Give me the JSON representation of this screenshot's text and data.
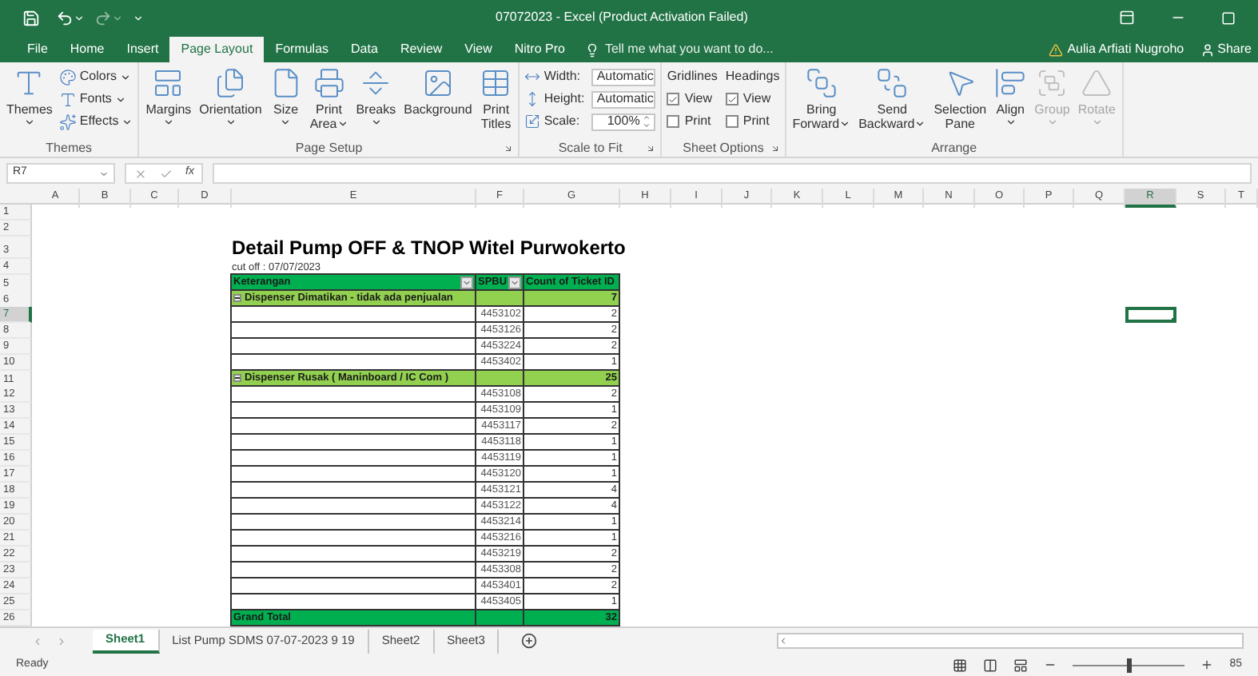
{
  "window": {
    "title": "07072023 - Excel (Product Activation Failed)"
  },
  "tabs": [
    {
      "label": "File",
      "selected": false
    },
    {
      "label": "Home",
      "selected": false
    },
    {
      "label": "Insert",
      "selected": false
    },
    {
      "label": "Page Layout",
      "selected": true
    },
    {
      "label": "Formulas",
      "selected": false
    },
    {
      "label": "Data",
      "selected": false
    },
    {
      "label": "Review",
      "selected": false
    },
    {
      "label": "View",
      "selected": false
    },
    {
      "label": "Nitro Pro",
      "selected": false
    }
  ],
  "tell_me": {
    "placeholder": "Tell me what you want to do..."
  },
  "account": {
    "name": "Aulia Arfiati Nugroho",
    "share": "Share"
  },
  "ribbon": {
    "groups": [
      {
        "label": "Themes",
        "launcher": false,
        "items": [
          {
            "kind": "large",
            "lines": [
              "Themes"
            ],
            "dropdown": true,
            "disabled": false
          },
          {
            "kind": "stack",
            "entries": [
              {
                "label": "Colors",
                "dropdown": true
              },
              {
                "label": "Fonts",
                "dropdown": true
              },
              {
                "label": "Effects",
                "dropdown": true
              }
            ]
          }
        ]
      },
      {
        "label": "Page Setup",
        "launcher": true,
        "items": [
          {
            "kind": "large",
            "lines": [
              "Margins"
            ],
            "dropdown": true,
            "disabled": false
          },
          {
            "kind": "large",
            "lines": [
              "Orientation"
            ],
            "dropdown": true,
            "disabled": false
          },
          {
            "kind": "large",
            "lines": [
              "Size"
            ],
            "dropdown": true,
            "disabled": false
          },
          {
            "kind": "large",
            "lines": [
              "Print",
              "Area"
            ],
            "dropdown": true,
            "disabled": false
          },
          {
            "kind": "large",
            "lines": [
              "Breaks"
            ],
            "dropdown": true,
            "disabled": false
          },
          {
            "kind": "large",
            "lines": [
              "Background"
            ],
            "dropdown": false,
            "disabled": false
          },
          {
            "kind": "large",
            "lines": [
              "Print",
              "Titles"
            ],
            "dropdown": false,
            "disabled": false
          }
        ]
      },
      {
        "label": "Scale to Fit",
        "launcher": true,
        "items": [
          {
            "kind": "scale",
            "rows": [
              {
                "label": "Width:",
                "value": "Automatic",
                "kind": "dropdown"
              },
              {
                "label": "Height:",
                "value": "Automatic",
                "kind": "dropdown"
              },
              {
                "label": "Scale:",
                "value": "100%",
                "kind": "spinner"
              }
            ]
          }
        ]
      },
      {
        "label": "Sheet Options",
        "launcher": true,
        "items": [
          {
            "kind": "options",
            "columns": [
              {
                "title": "Gridlines",
                "options": [
                  {
                    "label": "View",
                    "checked": true
                  },
                  {
                    "label": "Print",
                    "checked": false
                  }
                ]
              },
              {
                "title": "Headings",
                "options": [
                  {
                    "label": "View",
                    "checked": true
                  },
                  {
                    "label": "Print",
                    "checked": false
                  }
                ]
              }
            ]
          }
        ]
      },
      {
        "label": "Arrange",
        "launcher": false,
        "items": [
          {
            "kind": "large",
            "lines": [
              "Bring",
              "Forward"
            ],
            "dropdown": true,
            "disabled": false
          },
          {
            "kind": "large",
            "lines": [
              "Send",
              "Backward"
            ],
            "dropdown": true,
            "disabled": false
          },
          {
            "kind": "large",
            "lines": [
              "Selection",
              "Pane"
            ],
            "dropdown": false,
            "disabled": false
          },
          {
            "kind": "large",
            "lines": [
              "Align"
            ],
            "dropdown": true,
            "disabled": false
          },
          {
            "kind": "large",
            "lines": [
              "Group"
            ],
            "dropdown": true,
            "disabled": true
          },
          {
            "kind": "large",
            "lines": [
              "Rotate"
            ],
            "dropdown": true,
            "disabled": true
          }
        ]
      }
    ]
  },
  "formula_bar": {
    "name_box": "R7",
    "fx": "fx"
  },
  "columns": [
    {
      "label": "A",
      "selected": false
    },
    {
      "label": "B",
      "selected": false
    },
    {
      "label": "C",
      "selected": false
    },
    {
      "label": "D",
      "selected": false
    },
    {
      "label": "E",
      "selected": false
    },
    {
      "label": "F",
      "selected": false
    },
    {
      "label": "G",
      "selected": false
    },
    {
      "label": "H",
      "selected": false
    },
    {
      "label": "I",
      "selected": false
    },
    {
      "label": "J",
      "selected": false
    },
    {
      "label": "K",
      "selected": false
    },
    {
      "label": "L",
      "selected": false
    },
    {
      "label": "M",
      "selected": false
    },
    {
      "label": "N",
      "selected": false
    },
    {
      "label": "O",
      "selected": false
    },
    {
      "label": "P",
      "selected": false
    },
    {
      "label": "Q",
      "selected": false
    },
    {
      "label": "R",
      "selected": true
    },
    {
      "label": "S",
      "selected": false
    },
    {
      "label": "T",
      "selected": false
    }
  ],
  "rows": [
    {
      "label": "1",
      "selected": false
    },
    {
      "label": "2",
      "selected": false
    },
    {
      "label": "3",
      "selected": false
    },
    {
      "label": "4",
      "selected": false
    },
    {
      "label": "5",
      "selected": false
    },
    {
      "label": "6",
      "selected": false
    },
    {
      "label": "7",
      "selected": true
    },
    {
      "label": "8",
      "selected": false
    },
    {
      "label": "9",
      "selected": false
    },
    {
      "label": "10",
      "selected": false
    },
    {
      "label": "11",
      "selected": false
    },
    {
      "label": "12",
      "selected": false
    },
    {
      "label": "13",
      "selected": false
    },
    {
      "label": "14",
      "selected": false
    },
    {
      "label": "15",
      "selected": false
    },
    {
      "label": "16",
      "selected": false
    },
    {
      "label": "17",
      "selected": false
    },
    {
      "label": "18",
      "selected": false
    },
    {
      "label": "19",
      "selected": false
    },
    {
      "label": "20",
      "selected": false
    },
    {
      "label": "21",
      "selected": false
    },
    {
      "label": "22",
      "selected": false
    },
    {
      "label": "23",
      "selected": false
    },
    {
      "label": "24",
      "selected": false
    },
    {
      "label": "25",
      "selected": false
    },
    {
      "label": "26",
      "selected": false
    }
  ],
  "sheet": {
    "title": "Detail Pump OFF & TNOP Witel Purwokerto",
    "subtitle": "cut off : 07/07/2023",
    "pivot": {
      "headers": [
        {
          "label": "Keterangan",
          "filter": true
        },
        {
          "label": "SPBU",
          "filter": true
        },
        {
          "label": "Count of Ticket ID",
          "filter": false
        }
      ],
      "groups": [
        {
          "label": "Dispenser Dimatikan - tidak ada penjualan",
          "expanded": true,
          "total": "7",
          "rows": [
            {
              "spbu": "4453102",
              "count": "2"
            },
            {
              "spbu": "4453126",
              "count": "2"
            },
            {
              "spbu": "4453224",
              "count": "2"
            },
            {
              "spbu": "4453402",
              "count": "1"
            }
          ]
        },
        {
          "label": "Dispenser Rusak ( Maninboard / IC Com )",
          "expanded": true,
          "total": "25",
          "rows": [
            {
              "spbu": "4453108",
              "count": "2"
            },
            {
              "spbu": "4453109",
              "count": "1"
            },
            {
              "spbu": "4453117",
              "count": "2"
            },
            {
              "spbu": "4453118",
              "count": "1"
            },
            {
              "spbu": "4453119",
              "count": "1"
            },
            {
              "spbu": "4453120",
              "count": "1"
            },
            {
              "spbu": "4453121",
              "count": "4"
            },
            {
              "spbu": "4453122",
              "count": "4"
            },
            {
              "spbu": "4453214",
              "count": "1"
            },
            {
              "spbu": "4453216",
              "count": "1"
            },
            {
              "spbu": "4453219",
              "count": "2"
            },
            {
              "spbu": "4453308",
              "count": "2"
            },
            {
              "spbu": "4453401",
              "count": "2"
            },
            {
              "spbu": "4453405",
              "count": "1"
            }
          ]
        }
      ],
      "grand_total": {
        "label": "Grand Total",
        "value": "32"
      }
    }
  },
  "sheet_tabs": [
    {
      "label": "Sheet1",
      "selected": true
    },
    {
      "label": "List Pump SDMS 07-07-2023 9 19",
      "selected": false
    },
    {
      "label": "Sheet2",
      "selected": false
    },
    {
      "label": "Sheet3",
      "selected": false
    }
  ],
  "status_bar": {
    "text": "Ready",
    "zoom": {
      "level": 0.5,
      "value": "85"
    }
  }
}
